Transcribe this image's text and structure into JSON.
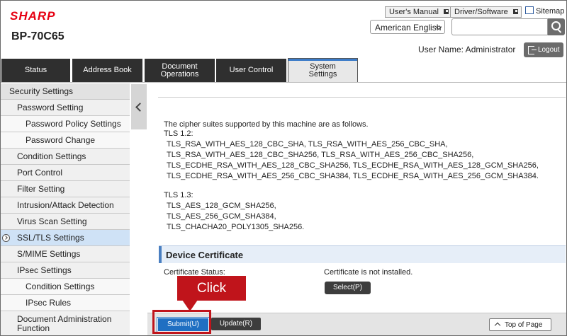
{
  "header": {
    "brand": "SHARP",
    "model": "BP-70C65",
    "users_manual": "User's Manual",
    "driver_software": "Driver/Software",
    "sitemap": "Sitemap",
    "language": "American English",
    "search_placeholder": "",
    "user_name": "User Name: Administrator",
    "logout": "Logout"
  },
  "tabs": [
    {
      "label": "Status"
    },
    {
      "label": "Address Book"
    },
    {
      "label": "Document\nOperations"
    },
    {
      "label": "User Control"
    },
    {
      "label": "System\nSettings",
      "active": true
    }
  ],
  "sidebar": {
    "items": [
      {
        "label": "Security Settings",
        "level": 0
      },
      {
        "label": "Password Setting",
        "level": 1
      },
      {
        "label": "Password Policy Settings",
        "level": 2
      },
      {
        "label": "Password Change",
        "level": 2
      },
      {
        "label": "Condition Settings",
        "level": 1
      },
      {
        "label": "Port Control",
        "level": 1
      },
      {
        "label": "Filter Setting",
        "level": 1
      },
      {
        "label": "Intrusion/Attack Detection",
        "level": 1
      },
      {
        "label": "Virus Scan Setting",
        "level": 1
      },
      {
        "label": "SSL/TLS Settings",
        "level": 1,
        "active": true
      },
      {
        "label": "S/MIME Settings",
        "level": 1
      },
      {
        "label": "IPsec Settings",
        "level": 1
      },
      {
        "label": "Condition Settings",
        "level": 2
      },
      {
        "label": "IPsec Rules",
        "level": 2
      },
      {
        "label": "Document Administration\nFunction",
        "level": 1
      }
    ]
  },
  "content": {
    "intro": "The cipher suites supported by this machine are as follows.",
    "tls12_label": "TLS 1.2:",
    "tls12_lines": [
      "TLS_RSA_WITH_AES_128_CBC_SHA, TLS_RSA_WITH_AES_256_CBC_SHA,",
      "TLS_RSA_WITH_AES_128_CBC_SHA256, TLS_RSA_WITH_AES_256_CBC_SHA256,",
      "TLS_ECDHE_RSA_WITH_AES_128_CBC_SHA256, TLS_ECDHE_RSA_WITH_AES_128_GCM_SHA256,",
      "TLS_ECDHE_RSA_WITH_AES_256_CBC_SHA384, TLS_ECDHE_RSA_WITH_AES_256_GCM_SHA384."
    ],
    "tls13_label": "TLS 1.3:",
    "tls13_lines": [
      "TLS_AES_128_GCM_SHA256,",
      "TLS_AES_256_GCM_SHA384,",
      "TLS_CHACHA20_POLY1305_SHA256."
    ],
    "device_cert_header": "Device Certificate",
    "cert_status_label": "Certificate Status:",
    "cert_status_value": "Certificate is not installed.",
    "select_button": "Select(P)"
  },
  "footer": {
    "submit": "Submit(U)",
    "update": "Update(R)",
    "top_of_page": "Top of Page"
  },
  "annotation": {
    "callout": "Click"
  },
  "colors": {
    "brand_red": "#e60012",
    "tab_dark": "#2f2f2f",
    "submit_blue": "#1f6fc2",
    "callout_red": "#c0141b",
    "active_nav": "#cfe2f6"
  }
}
